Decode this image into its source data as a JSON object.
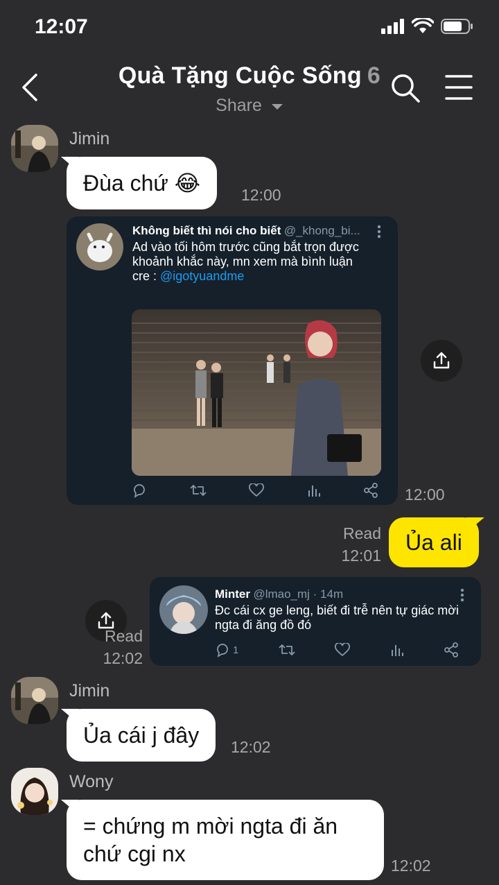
{
  "status_bar": {
    "time": "12:07"
  },
  "header": {
    "title": "Quà Tặng Cuộc Sống",
    "member_count": "6",
    "subtitle": "Share"
  },
  "messages": [
    {
      "sender": "Jimin",
      "text": "Đùa chứ 😂",
      "time": "12:00"
    },
    {
      "type": "tweet",
      "time": "12:00",
      "author": "Không biết thì nói cho biết",
      "handle": "@_khong_bi...",
      "text_line1": "Ad vào tối hôm trước cũng bắt trọn được",
      "text_line2": "khoảnh khắc này, mn xem mà bình luận",
      "text_line3": "cre : ",
      "link": "@igotyuandme"
    },
    {
      "type": "outgoing",
      "text": "Ủa ali",
      "read": "Read",
      "time": "12:01"
    },
    {
      "type": "tweet_outgoing",
      "read": "Read",
      "time": "12:02",
      "author": "Minter",
      "handle": "@lmao_mj · 14m",
      "text_line1": "Đc cái cx ge leng, biết đi trễ nên tự giác mời",
      "text_line2": "ngta đi ăng đồ đó",
      "reply_count": "1"
    },
    {
      "sender": "Jimin",
      "text": "Ủa cái j đây",
      "time": "12:02"
    },
    {
      "sender": "Wony",
      "text_line1": "= chứng m mời ngta đi ăn",
      "text_line2": "chứ cgi nx",
      "time": "12:02"
    }
  ],
  "colors": {
    "background": "#2c2c2e",
    "outgoing_bubble": "#fee500",
    "incoming_bubble": "#ffffff",
    "tweet_card": "#15202b",
    "link": "#1d9bf0"
  }
}
